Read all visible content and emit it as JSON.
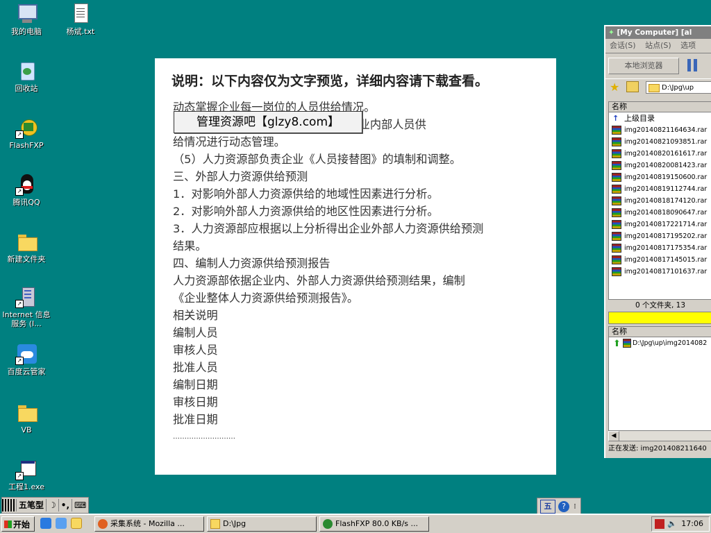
{
  "desktop": {
    "icons": [
      {
        "label": "我的电脑"
      },
      {
        "label": "杨斌.txt"
      },
      {
        "label": "回收站"
      },
      {
        "label": "FlashFXP"
      },
      {
        "label": "腾讯QQ"
      },
      {
        "label": "新建文件夹"
      },
      {
        "label": "Internet 信息服务 (I..."
      },
      {
        "label": "百度云管家"
      },
      {
        "label": "VB"
      },
      {
        "label": "工程1.exe"
      }
    ]
  },
  "document": {
    "title": "说明：以下内容仅为文字预览，详细内容请下载查看。",
    "watermark": "管理资源吧【glzy8.com】",
    "lines": [
      "动态掌握企业每一岗位的人员供给情况。",
      "                              模型方法，对企业内部人员供",
      "给情况进行动态管理。",
      "（5）人力资源部负责企业《人员接替图》的填制和调整。",
      "三、外部人力资源供给预测",
      "1．对影响外部人力资源供给的地域性因素进行分析。",
      "2．对影响外部人力资源供给的地区性因素进行分析。",
      "3．人力资源部应根据以上分析得出企业外部人力资源供给预测",
      "结果。",
      "四、编制人力资源供给预测报告",
      "人力资源部依据企业内、外部人力资源供给预测结果，编制",
      "《企业整体人力资源供给预测报告》。",
      "相关说明",
      "编制人员",
      "审核人员",
      "批准人员",
      "编制日期",
      "审核日期",
      "批准日期",
      "………………………"
    ]
  },
  "flashfxp": {
    "title": "[My Computer]  [al",
    "menu": [
      "会话(S)",
      "站点(S)",
      "选项"
    ],
    "local_browser": "本地浏览器",
    "path": "D:\\Jpg\\up",
    "column_name": "名称",
    "parent_dir": "上级目录",
    "files": [
      "img20140821164634.rar",
      "img20140821093851.rar",
      "img20140820161617.rar",
      "img20140820081423.rar",
      "img20140819150600.rar",
      "img20140819112744.rar",
      "img20140818174120.rar",
      "img20140818090647.rar",
      "img20140817221714.rar",
      "img20140817195202.rar",
      "img20140817175354.rar",
      "img20140817145015.rar",
      "img20140817101637.rar"
    ],
    "status_count": "0 个文件夹, 13",
    "queue_column": "名称",
    "queue_item": "D:\\Jpg\\up\\img2014082",
    "sending": "正在发送: img201408211640"
  },
  "ime": {
    "mode": "五笔型"
  },
  "taskbar": {
    "start": "开始",
    "tasks": [
      "采集系统 - Mozilla ...",
      "D:\\Jpg",
      "FlashFXP 80.0 KB/s ..."
    ],
    "clock": "17:06"
  }
}
